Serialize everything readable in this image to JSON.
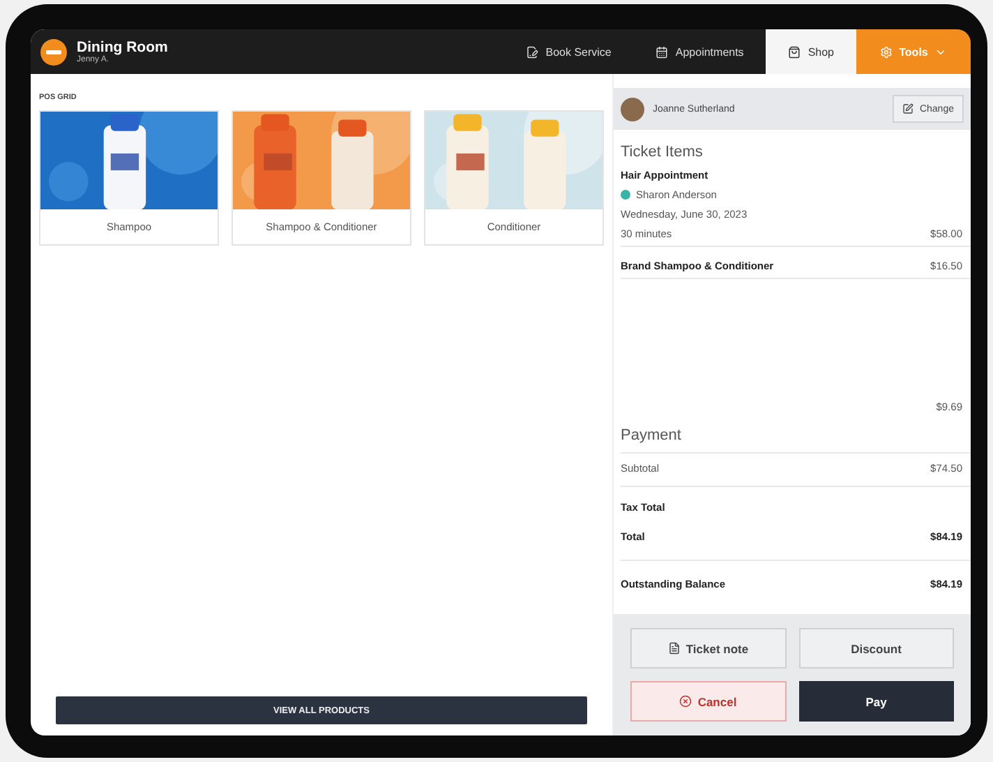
{
  "header": {
    "title": "Dining Room",
    "subtitle": "Jenny A."
  },
  "tabs": [
    {
      "label": "Book Service",
      "kind": "tab",
      "selected": false
    },
    {
      "label": "Appointments",
      "kind": "tab",
      "selected": false
    },
    {
      "label": "Shop",
      "kind": "tab",
      "selected": true
    },
    {
      "label": "Tools",
      "kind": "menu",
      "selected": false
    }
  ],
  "pos_grid": {
    "label": "POS GRID",
    "products": [
      {
        "name": "Shampoo"
      },
      {
        "name": "Shampoo & Conditioner"
      },
      {
        "name": "Conditioner"
      }
    ],
    "view_all": "VIEW ALL PRODUCTS"
  },
  "customer": {
    "name": "Joanne Sutherland",
    "change": "Change"
  },
  "ticket": {
    "title": "Ticket Items",
    "items": [
      {
        "kind": "appointment",
        "name": "Hair Appointment",
        "staff": "Sharon Anderson",
        "color": "#3bb3a6",
        "date": "Wednesday, June 30, 2023",
        "duration": "30 minutes",
        "price": "$58.00"
      },
      {
        "kind": "product",
        "name": "Brand Shampoo & Conditioner",
        "price": "$16.50"
      },
      {
        "kind": "amount",
        "price": "$9.69"
      }
    ]
  },
  "payment": {
    "title": "Payment",
    "rows": [
      {
        "label": "Subtotal",
        "value": "$74.50",
        "bold": false
      },
      {
        "label": "Tax Total",
        "bold": true
      },
      {
        "label": "Total",
        "value": "$84.19",
        "bold": true
      },
      {
        "label": "Outstanding Balance",
        "value": "$84.19",
        "bold": true
      }
    ]
  },
  "actions": {
    "ticket_note": "Ticket note",
    "discount": "Discount",
    "cancel": "Cancel",
    "pay": "Pay"
  }
}
